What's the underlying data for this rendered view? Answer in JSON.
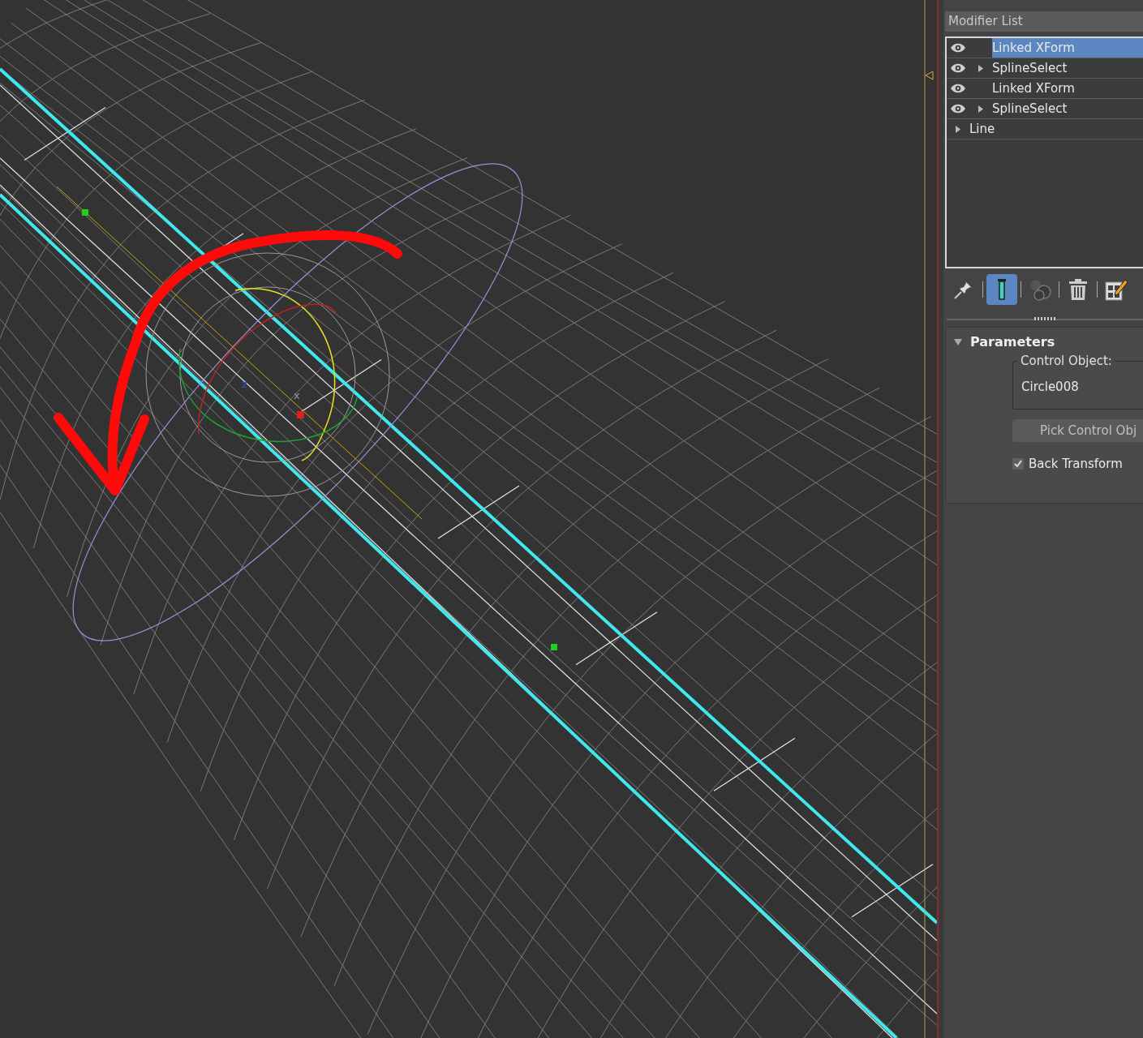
{
  "viewport": {
    "gizmo_labels": [
      "z",
      "x"
    ]
  },
  "modifier_panel": {
    "title": "Modifier List",
    "stack": [
      {
        "kind": "modifier",
        "label": "Linked XForm",
        "visible": true,
        "expandable": false,
        "selected": true
      },
      {
        "kind": "modifier",
        "label": "SplineSelect",
        "visible": true,
        "expandable": true,
        "selected": false
      },
      {
        "kind": "modifier",
        "label": "Linked XForm",
        "visible": true,
        "expandable": false,
        "selected": false
      },
      {
        "kind": "modifier",
        "label": "SplineSelect",
        "visible": true,
        "expandable": true,
        "selected": false
      },
      {
        "kind": "base",
        "label": "Line",
        "expandable": true,
        "selected": false
      }
    ],
    "toolbar": [
      {
        "kind": "pin",
        "on": false
      },
      {
        "kind": "end_result",
        "on": true
      },
      {
        "kind": "make_unique",
        "on": false
      },
      {
        "kind": "remove",
        "on": false
      },
      {
        "kind": "configure",
        "on": false
      }
    ],
    "rollout": {
      "title": "Parameters",
      "expanded": true,
      "group_label": "Control Object:",
      "control_object": "Circle008",
      "pick_button": "Pick Control Obj",
      "back_transform": {
        "label": "Back Transform",
        "checked": true
      }
    }
  }
}
